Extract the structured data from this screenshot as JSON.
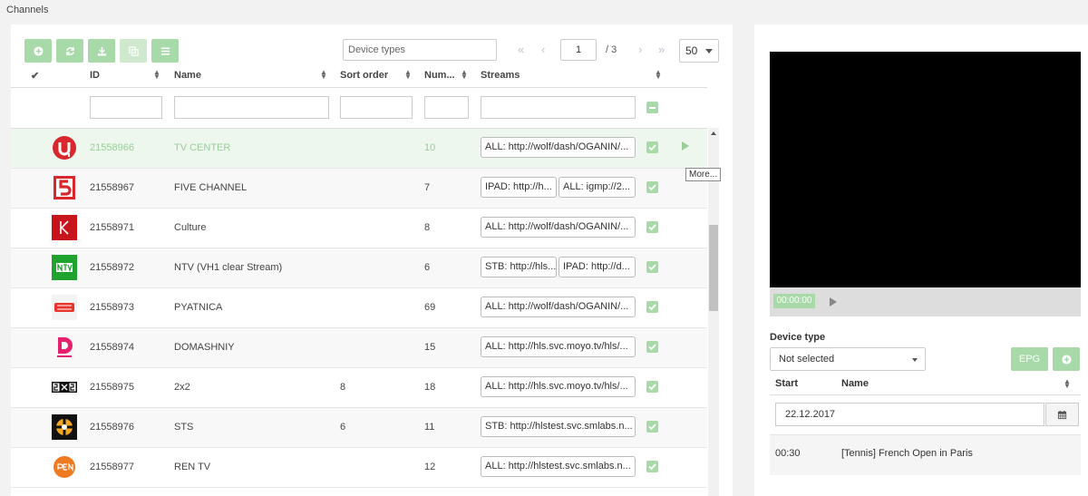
{
  "page": {
    "breadcrumb": "Channels"
  },
  "toolbar": {
    "buttons": [
      {
        "name": "add-button",
        "icon": "plus-circle-icon"
      },
      {
        "name": "refresh-button",
        "icon": "refresh-icon"
      },
      {
        "name": "download-button",
        "icon": "download-icon"
      },
      {
        "name": "copy-button",
        "icon": "copy-icon"
      },
      {
        "name": "menu-button",
        "icon": "list-icon"
      }
    ],
    "search_placeholder": "Device types",
    "page_current": "1",
    "page_total": "/ 3",
    "page_size": "50"
  },
  "table": {
    "headers": {
      "id": "ID",
      "name": "Name",
      "sort_order": "Sort order",
      "number": "Num...",
      "streams": "Streams"
    },
    "rows": [
      {
        "id": "21558966",
        "name": "TV CENTER",
        "sort": "",
        "num": "10",
        "streams": [
          "ALL: http://wolf/dash/OGANIN/..."
        ],
        "logo": "tv-center-logo",
        "selected": true
      },
      {
        "id": "21558967",
        "name": "FIVE CHANNEL",
        "sort": "",
        "num": "7",
        "streams": [
          "IPAD: http://h...",
          "ALL: igmp://2..."
        ],
        "logo": "five-channel-logo"
      },
      {
        "id": "21558971",
        "name": "Culture",
        "sort": "",
        "num": "8",
        "streams": [
          "ALL: http://wolf/dash/OGANIN/..."
        ],
        "logo": "culture-logo"
      },
      {
        "id": "21558972",
        "name": "NTV (VH1 clear Stream)",
        "sort": "",
        "num": "6",
        "streams": [
          "STB: http://hls...",
          "IPAD: http://d..."
        ],
        "logo": "ntv-logo"
      },
      {
        "id": "21558973",
        "name": "PYATNICA",
        "sort": "",
        "num": "69",
        "streams": [
          "ALL: http://wolf/dash/OGANIN/..."
        ],
        "logo": "pyatnica-logo"
      },
      {
        "id": "21558974",
        "name": "DOMASHNIY",
        "sort": "",
        "num": "15",
        "streams": [
          "ALL: http://hls.svc.moyo.tv/hls/..."
        ],
        "logo": "domashniy-logo"
      },
      {
        "id": "21558975",
        "name": "2x2",
        "sort": "8",
        "num": "18",
        "streams": [
          "ALL: http://hls.svc.moyo.tv/hls/..."
        ],
        "logo": "2x2-logo"
      },
      {
        "id": "21558976",
        "name": "STS",
        "sort": "6",
        "num": "11",
        "streams": [
          "STB: http://hlstest.svc.smlabs.n..."
        ],
        "logo": "sts-logo"
      },
      {
        "id": "21558977",
        "name": "REN TV",
        "sort": "",
        "num": "12",
        "streams": [
          "ALL: http://hlstest.svc.smlabs.n..."
        ],
        "logo": "ren-tv-logo"
      }
    ],
    "tooltip": "More..."
  },
  "player": {
    "time": "00:00:00"
  },
  "epg": {
    "device_type_label": "Device type",
    "device_type_value": "Not selected",
    "epg_button": "EPG",
    "col_start": "Start",
    "col_name": "Name",
    "date": "22.12.2017",
    "programs": [
      {
        "start": "00:30",
        "name": "[Tennis] French Open in Paris"
      }
    ]
  },
  "colors": {
    "accent_green": "#a8d9a8",
    "selected_row": "#eef7ee"
  }
}
